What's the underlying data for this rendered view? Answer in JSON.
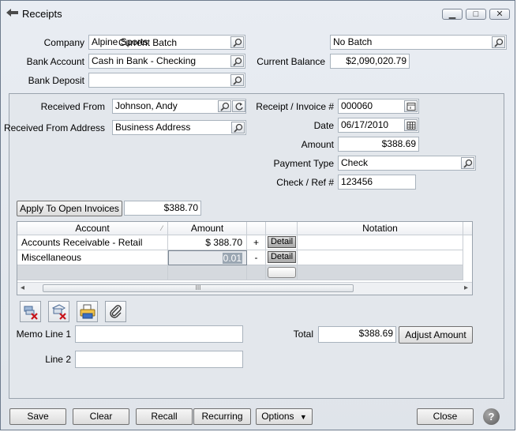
{
  "window": {
    "title": "Receipts",
    "minimize_glyph": "▁",
    "maximize_glyph": "□",
    "close_glyph": "✕"
  },
  "header": {
    "company_label": "Company",
    "company_value": "Alpine Sports",
    "bank_account_label": "Bank Account",
    "bank_account_value": "Cash in Bank - Checking",
    "bank_deposit_label": "Bank Deposit",
    "bank_deposit_value": "",
    "current_batch_label": "Current Batch",
    "current_batch_value": "No Batch",
    "current_balance_label": "Current Balance",
    "current_balance_value": "$2,090,020.79"
  },
  "receipt": {
    "received_from_label": "Received From",
    "received_from_value": "Johnson, Andy",
    "received_from_address_label": "Received From Address",
    "received_from_address_value": "Business Address",
    "receipt_invoice_label": "Receipt / Invoice #",
    "receipt_invoice_value": "000060",
    "date_label": "Date",
    "date_value": "06/17/2010",
    "amount_label": "Amount",
    "amount_value": "$388.69",
    "payment_type_label": "Payment Type",
    "payment_type_value": "Check",
    "check_ref_label": "Check / Ref #",
    "check_ref_value": "123456"
  },
  "apply": {
    "button_label": "Apply To Open Invoices",
    "value": "$388.70"
  },
  "grid": {
    "columns": [
      "Account",
      "Amount",
      "Notation"
    ],
    "rows": [
      {
        "account": "Accounts Receivable - Retail",
        "amount": "$ 388.70",
        "sign": "+",
        "detail": "Detail",
        "notation": ""
      },
      {
        "account": "Miscellaneous",
        "amount": "0.01",
        "sign": "-",
        "detail": "Detail",
        "notation": ""
      }
    ],
    "scroll_left": "◂",
    "scroll_right": "▸",
    "scroll_grip": "III"
  },
  "toolbar_icons": [
    "delete-row-icon",
    "delete-invoice-icon",
    "print-icon",
    "attachment-icon"
  ],
  "memo": {
    "memo_line1_label": "Memo Line 1",
    "memo_line1_value": "",
    "line2_label": "Line 2",
    "line2_value": ""
  },
  "totals": {
    "total_label": "Total",
    "total_value": "$388.69",
    "adjust_label": "Adjust Amount"
  },
  "footer": {
    "save_label": "Save",
    "clear_label": "Clear",
    "recall_label": "Recall",
    "recurring_label": "Recurring",
    "options_label": "Options",
    "close_label": "Close",
    "help_glyph": "?"
  },
  "colors": {
    "selected_cell": "#9aa6b2",
    "window_bg": "#e3e7ec",
    "help_button": "#6b6b6b"
  }
}
